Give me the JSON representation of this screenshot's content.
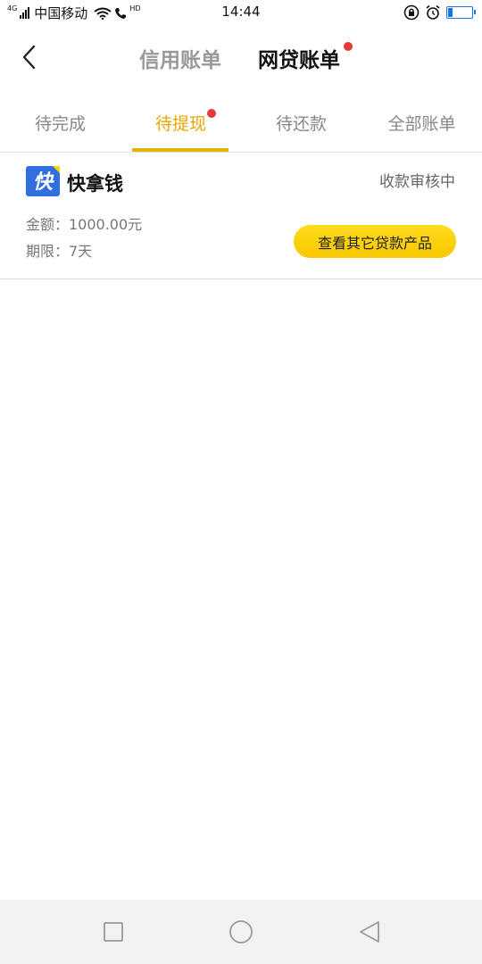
{
  "status_bar": {
    "network_type": "4G",
    "carrier": "中国移动",
    "hd_label": "HD",
    "time": "14:44",
    "battery_level": 0.2
  },
  "header": {
    "tabs": [
      {
        "label": "信用账单",
        "active": false,
        "has_dot": false
      },
      {
        "label": "网贷账单",
        "active": true,
        "has_dot": true
      }
    ]
  },
  "subtabs": [
    {
      "label": "待完成",
      "active": false,
      "has_dot": false
    },
    {
      "label": "待提现",
      "active": true,
      "has_dot": true
    },
    {
      "label": "待还款",
      "active": false,
      "has_dot": false
    },
    {
      "label": "全部账单",
      "active": false,
      "has_dot": false
    }
  ],
  "loan": {
    "logo_char": "快",
    "product_name": "快拿钱",
    "status": "收款审核中",
    "amount_label": "金额：1000.00元",
    "term_label": "期限：7天",
    "cta_label": "查看其它贷款产品"
  },
  "colors": {
    "accent": "#e9a500",
    "button": "#ffd400",
    "dot": "#e53935",
    "logo_blue": "#2f6fe0"
  },
  "icons": {
    "back": "chevron-left-icon",
    "nav_recent": "square-icon",
    "nav_home": "circle-icon",
    "nav_back": "triangle-left-icon"
  }
}
